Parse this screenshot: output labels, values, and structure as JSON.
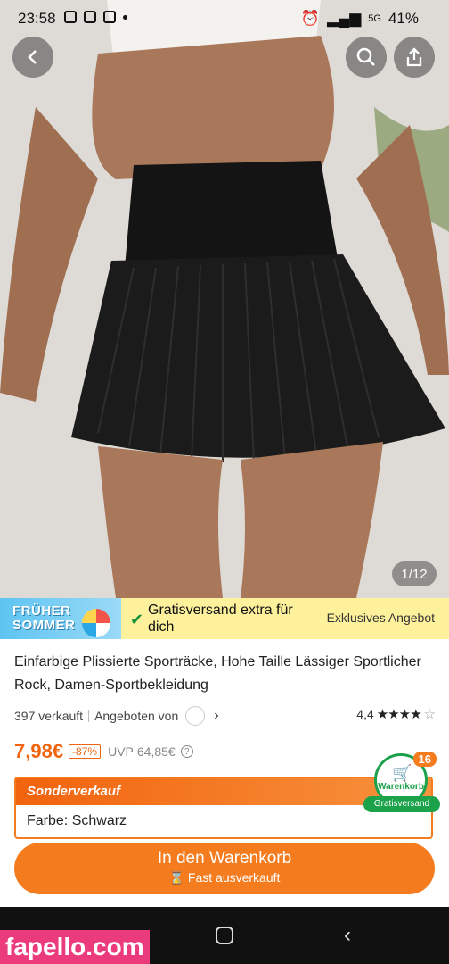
{
  "status": {
    "time": "23:58",
    "battery": "41%",
    "network": "5G"
  },
  "gallery": {
    "counter": "1/12"
  },
  "promo": {
    "early_label": "FRÜHER\nSOMMER",
    "free_shipping": "Gratisversand extra für dich",
    "exclusive": "Exklusives Angebot"
  },
  "product": {
    "title": "Einfarbige Plissierte Sporträcke, Hohe Taille Lässiger Sportlicher Rock, Damen-Sportbekleidung",
    "sold": "397 verkauft",
    "offered_by": "Angeboten von",
    "rating_value": "4,4",
    "rating": 4.4,
    "price": "7,98€",
    "discount": "-87%",
    "uvp_label": "UVP",
    "old_price": "64,85€"
  },
  "special": {
    "heading": "Sonderverkauf",
    "color_label": "Farbe: Schwarz"
  },
  "cart_badge": {
    "count": "16",
    "label": "Warenkorb",
    "shipping": "Gratisversand"
  },
  "cta": {
    "label": "In den Warenkorb",
    "sub": "⌛ Fast ausverkauft"
  },
  "watermark": "fapello.com",
  "colors": {
    "accent": "#f47c1e",
    "green": "#1ca24a",
    "promo_bg": "#fdf19c"
  }
}
